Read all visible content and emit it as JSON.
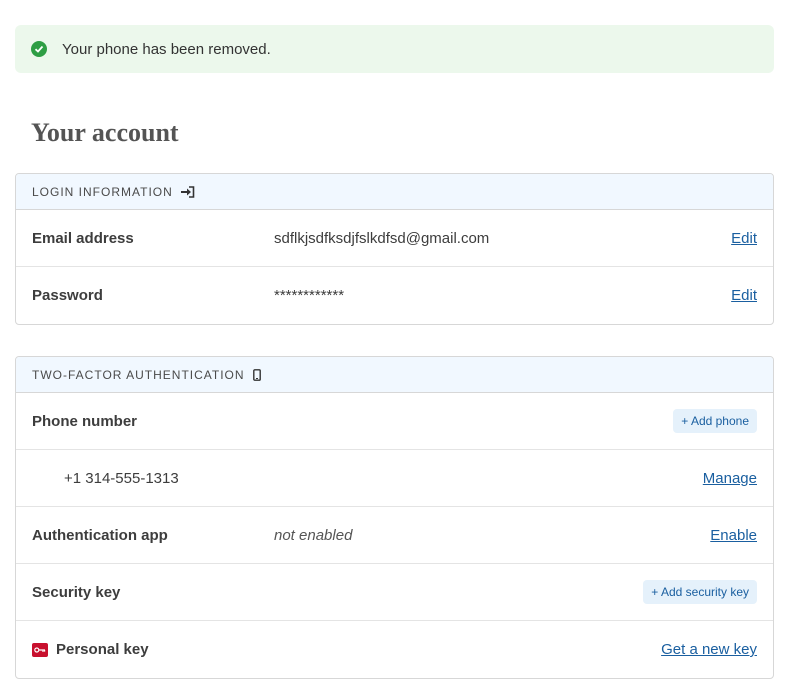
{
  "alert": {
    "message": "Your phone has been removed.",
    "icon": "check-circle-icon",
    "color": "#2e9e44"
  },
  "page": {
    "title": "Your account"
  },
  "login_section": {
    "header": "LOGIN INFORMATION",
    "header_icon": "sign-in-icon",
    "rows": [
      {
        "label": "Email address",
        "value": "sdflkjsdfksdjfslkdfsd@gmail.com",
        "action": "Edit"
      },
      {
        "label": "Password",
        "value": "************",
        "action": "Edit"
      }
    ]
  },
  "twofa_section": {
    "header": "TWO-FACTOR AUTHENTICATION",
    "header_icon": "mobile-phone-icon",
    "phone_label": "Phone number",
    "add_phone": "+ Add phone",
    "phone_value": "+1 314-555-1313",
    "manage": "Manage",
    "auth_app_label": "Authentication app",
    "auth_app_status": "not enabled",
    "enable": "Enable",
    "security_key_label": "Security key",
    "add_security_key": "+ Add security key",
    "personal_key_label": "Personal key",
    "personal_key_icon": "key-icon",
    "get_new_key": "Get a new key"
  },
  "colors": {
    "link": "#1a5fa0",
    "header_bg": "#f1f8ff",
    "alert_bg": "#ecf8ec",
    "key_red": "#c8102e"
  }
}
